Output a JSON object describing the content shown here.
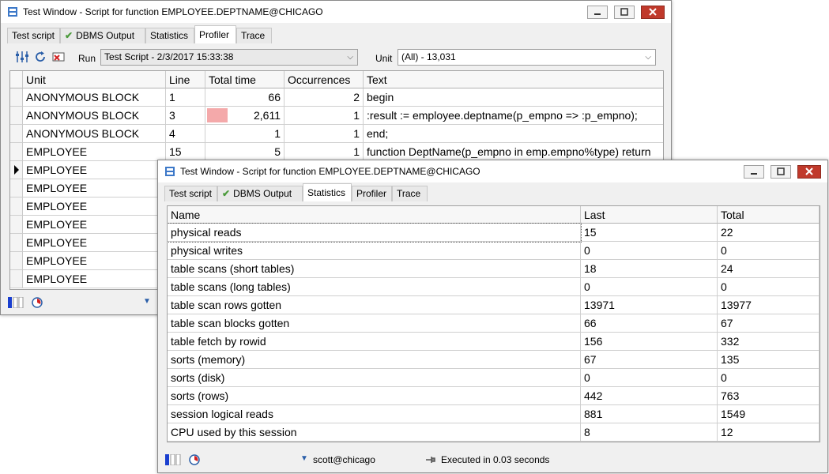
{
  "back_window": {
    "title": "Test Window - Script for function EMPLOYEE.DEPTNAME@CHICAGO",
    "tabs": [
      "Test script",
      "DBMS Output",
      "Statistics",
      "Profiler",
      "Trace"
    ],
    "active_tab": "Profiler",
    "toolbar": {
      "run_label": "Run",
      "run_value": "Test Script - 2/3/2017 15:33:38",
      "unit_label": "Unit",
      "unit_value": "(All) - 13,031"
    },
    "columns": [
      "Unit",
      "Line",
      "Total time",
      "Occurrences",
      "Text"
    ],
    "rows": [
      {
        "unit": "ANONYMOUS BLOCK",
        "line": "1",
        "total_time": "66",
        "occurrences": "2",
        "text": "begin",
        "bar": 0
      },
      {
        "unit": "ANONYMOUS BLOCK",
        "line": "3",
        "total_time": "2,611",
        "occurrences": "1",
        "text": ":result := employee.deptname(p_empno => :p_empno);",
        "bar": 1
      },
      {
        "unit": "ANONYMOUS BLOCK",
        "line": "4",
        "total_time": "1",
        "occurrences": "1",
        "text": "end;",
        "bar": 0
      },
      {
        "unit": "EMPLOYEE",
        "line": "15",
        "total_time": "5",
        "occurrences": "1",
        "text": "function DeptName(p_empno in emp.empno%type) return",
        "bar": 0
      },
      {
        "unit": "EMPLOYEE",
        "line": "",
        "total_time": "",
        "occurrences": "",
        "text": "",
        "bar": 0
      },
      {
        "unit": "EMPLOYEE",
        "line": "",
        "total_time": "",
        "occurrences": "",
        "text": "",
        "bar": 0
      },
      {
        "unit": "EMPLOYEE",
        "line": "",
        "total_time": "",
        "occurrences": "",
        "text": "",
        "bar": 0
      },
      {
        "unit": "EMPLOYEE",
        "line": "",
        "total_time": "",
        "occurrences": "",
        "text": "",
        "bar": 0
      },
      {
        "unit": "EMPLOYEE",
        "line": "",
        "total_time": "",
        "occurrences": "",
        "text": "",
        "bar": 0
      },
      {
        "unit": "EMPLOYEE",
        "line": "",
        "total_time": "",
        "occurrences": "",
        "text": "",
        "bar": 0
      },
      {
        "unit": "EMPLOYEE",
        "line": "",
        "total_time": "",
        "occurrences": "",
        "text": "",
        "bar": 0
      }
    ],
    "bar_color": "#f4a9aa"
  },
  "front_window": {
    "title": "Test Window - Script for function EMPLOYEE.DEPTNAME@CHICAGO",
    "tabs": [
      "Test script",
      "DBMS Output",
      "Statistics",
      "Profiler",
      "Trace"
    ],
    "active_tab": "Statistics",
    "columns": [
      "Name",
      "Last",
      "Total"
    ],
    "rows": [
      {
        "name": "physical reads",
        "last": "15",
        "total": "22"
      },
      {
        "name": "physical writes",
        "last": "0",
        "total": "0"
      },
      {
        "name": "table scans (short tables)",
        "last": "18",
        "total": "24"
      },
      {
        "name": "table scans (long tables)",
        "last": "0",
        "total": "0"
      },
      {
        "name": "table scan rows gotten",
        "last": "13971",
        "total": "13977"
      },
      {
        "name": "table scan blocks gotten",
        "last": "66",
        "total": "67"
      },
      {
        "name": "table fetch by rowid",
        "last": "156",
        "total": "332"
      },
      {
        "name": "sorts (memory)",
        "last": "67",
        "total": "135"
      },
      {
        "name": "sorts (disk)",
        "last": "0",
        "total": "0"
      },
      {
        "name": "sorts (rows)",
        "last": "442",
        "total": "763"
      },
      {
        "name": "session logical reads",
        "last": "881",
        "total": "1549"
      },
      {
        "name": "CPU used by this session",
        "last": "8",
        "total": "12"
      }
    ],
    "status": {
      "connection": "scott@chicago",
      "message": "Executed in 0.03 seconds"
    }
  },
  "icons": {
    "window": "database-window-icon",
    "minimize": "minimize-icon",
    "maximize": "maximize-icon",
    "close": "close-icon",
    "check": "check-icon"
  },
  "colors": {
    "close_button": "#c0392b",
    "check": "#4c9b3c",
    "status_blue": "#1a3fcf"
  }
}
